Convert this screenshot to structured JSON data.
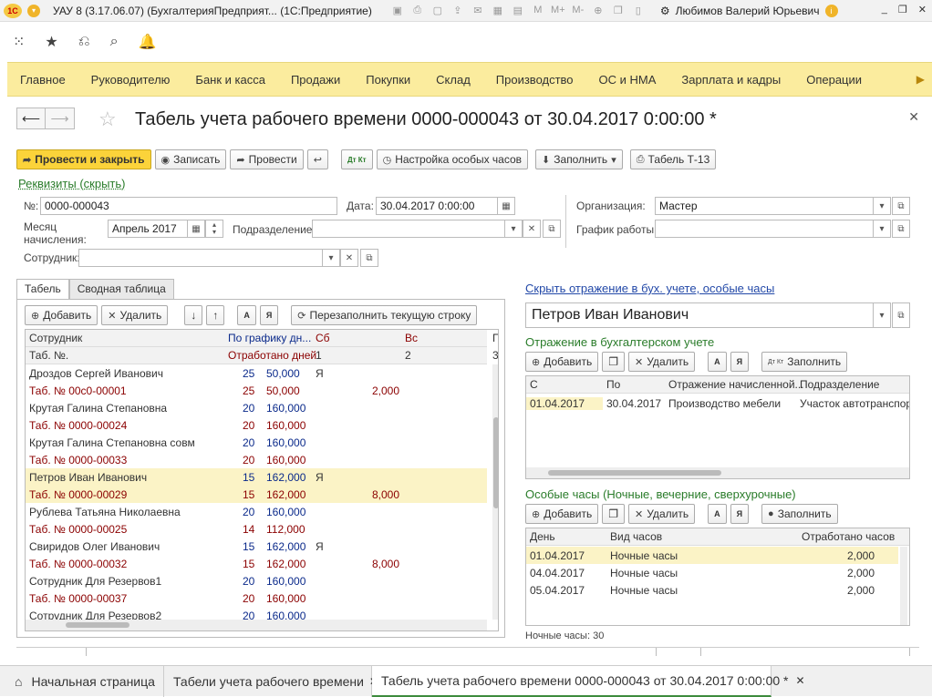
{
  "titlebar": {
    "app_title": "УАУ 8 (3.17.06.07) (БухгалтерияПредприят... (1С:Предприятие)",
    "user": "Любимов Валерий Юрьевич",
    "logo": "1С"
  },
  "main_menu": [
    "Главное",
    "Руководителю",
    "Банк и касса",
    "Продажи",
    "Покупки",
    "Склад",
    "Производство",
    "ОС и НМА",
    "Зарплата и кадры",
    "Операции"
  ],
  "document": {
    "title": "Табель учета рабочего времени 0000-000043 от 30.04.2017 0:00:00 *"
  },
  "toolbar": {
    "post_close": "Провести и закрыть",
    "save": "Записать",
    "post": "Провести",
    "special_hours": "Настройка особых часов",
    "fill": "Заполнить",
    "t13": "Табель Т-13",
    "dt_kt": "Дт Кт"
  },
  "requisites": {
    "toggle_link": "Реквизиты (скрыть)",
    "number_label": "№:",
    "number_value": "0000-000043",
    "date_label": "Дата:",
    "date_value": "30.04.2017  0:00:00",
    "org_label": "Организация:",
    "org_value": "Мастер",
    "month_label_1": "Месяц",
    "month_label_2": "начисления:",
    "month_value": "Апрель 2017",
    "dept_label": "Подразделение:",
    "dept_value": "",
    "schedule_label": "График работы:",
    "schedule_value": "",
    "employee_label": "Сотрудник:",
    "employee_value": ""
  },
  "tabs": [
    "Табель",
    "Сводная таблица"
  ],
  "left_toolbar": {
    "add": "Добавить",
    "delete": "Удалить",
    "refill": "Перезаполнить текущую строку",
    "sort_a": "А",
    "sort_ya": "Я"
  },
  "grid": {
    "header1": [
      "Сотрудник",
      "По графику дн...",
      "Сб",
      "Вс",
      "П"
    ],
    "header2": [
      "Таб. №.",
      "Отработано дней",
      "1",
      "2",
      "3"
    ],
    "rows": [
      {
        "name": "Дроздов Сергей Иванович",
        "tab": "Таб. № 00с0-00001",
        "days1": "25",
        "hours1": "50,000",
        "days2": "25",
        "hours2": "50,000",
        "sat1": "Я",
        "sat2": "2,000"
      },
      {
        "name": "Крутая Галина Степановна",
        "tab": "Таб. № 0000-00024",
        "days1": "20",
        "hours1": "160,000",
        "days2": "20",
        "hours2": "160,000",
        "sat1": "",
        "sat2": ""
      },
      {
        "name": "Крутая Галина Степановна совм",
        "tab": "Таб. № 0000-00033",
        "days1": "20",
        "hours1": "160,000",
        "days2": "20",
        "hours2": "160,000",
        "sat1": "",
        "sat2": ""
      },
      {
        "name": "Петров Иван Иванович",
        "tab": "Таб. № 0000-00029",
        "days1": "15",
        "hours1": "162,000",
        "days2": "15",
        "hours2": "162,000",
        "sat1": "Я",
        "sat2": "8,000"
      },
      {
        "name": "Рублева Татьяна Николаевна",
        "tab": "Таб. № 0000-00025",
        "days1": "20",
        "hours1": "160,000",
        "days2": "14",
        "hours2": "112,000",
        "sat1": "",
        "sat2": ""
      },
      {
        "name": "Свиридов Олег Иванович",
        "tab": "Таб. № 0000-00032",
        "days1": "15",
        "hours1": "162,000",
        "days2": "15",
        "hours2": "162,000",
        "sat1": "Я",
        "sat2": "8,000"
      },
      {
        "name": "Сотрудник Для Резервов1",
        "tab": "Таб. № 0000-00037",
        "days1": "20",
        "hours1": "160,000",
        "days2": "20",
        "hours2": "160,000",
        "sat1": "",
        "sat2": ""
      },
      {
        "name": "Сотрудник Для Резервов2",
        "tab": "",
        "days1": "20",
        "hours1": "160,000",
        "days2": "",
        "hours2": "",
        "sat1": "",
        "sat2": ""
      }
    ]
  },
  "right": {
    "hide_link": "Скрыть отражение в бух. учете, особые часы",
    "employee": "Петров Иван Иванович",
    "acc_head": "Отражение в бухгалтерском учете",
    "add": "Добавить",
    "delete": "Удалить",
    "fill": "Заполнить",
    "acc_cols": [
      "С",
      "По",
      "Отражение начисленной...",
      "Подразделение"
    ],
    "acc_row": [
      "01.04.2017",
      "30.04.2017",
      "Производство мебели",
      "Участок автотранспорта"
    ],
    "special_head": "Особые часы (Ночные, вечерние, сверхурочные)",
    "sp_cols": [
      "День",
      "Вид часов",
      "Отработано часов"
    ],
    "sp_rows": [
      [
        "01.04.2017",
        "Ночные часы",
        "2,000"
      ],
      [
        "04.04.2017",
        "Ночные часы",
        "2,000"
      ],
      [
        "05.04.2017",
        "Ночные часы",
        "2,000"
      ]
    ],
    "night_total": "Ночные часы: 30"
  },
  "bottom_tabs": {
    "home": "Начальная страница",
    "list": "Табели учета рабочего времени",
    "current": "Табель учета рабочего времени 0000-000043 от 30.04.2017 0:00:00 *"
  }
}
